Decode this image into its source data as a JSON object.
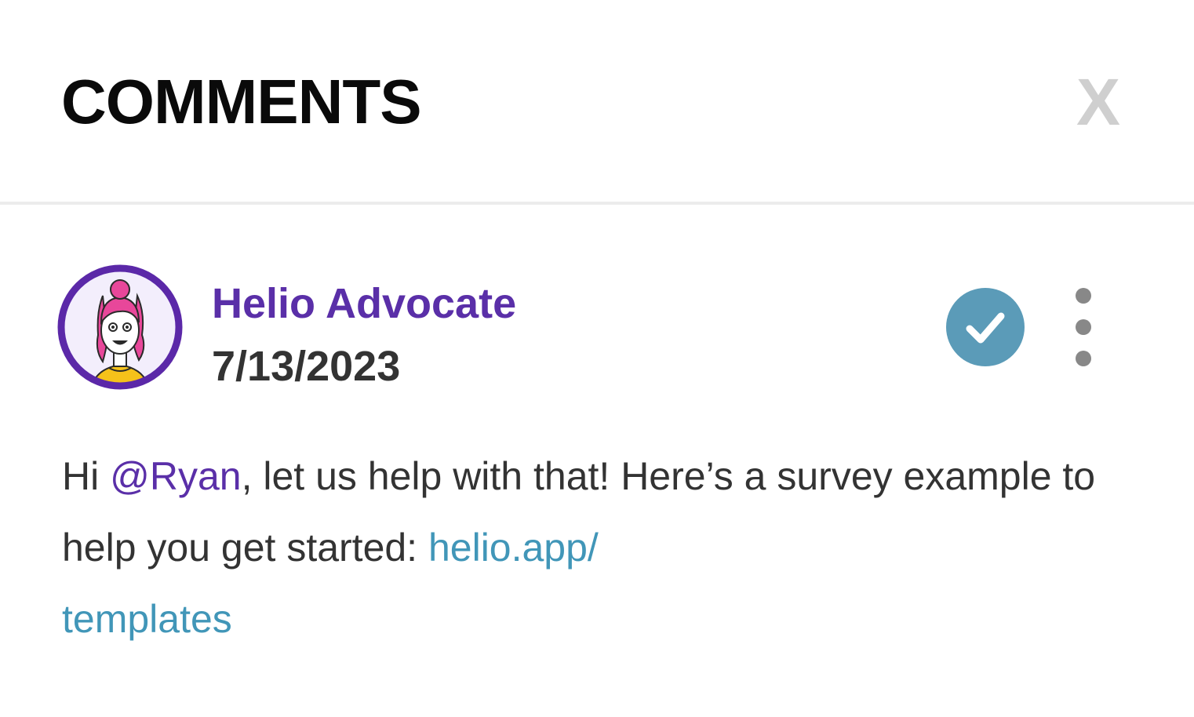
{
  "header": {
    "title": "COMMENTS",
    "close_label": "X"
  },
  "comment": {
    "author": "Helio Advocate",
    "date": "7/13/2023",
    "avatar_icon": "illustrated-woman-avatar",
    "resolve_icon": "check-circle-icon",
    "more_icon": "kebab-menu-icon",
    "body": {
      "text_before_mention": "Hi ",
      "mention": "@Ryan",
      "text_after_mention": ", let us help with that! Here’s a survey example to help you get started: ",
      "link_line1": "helio.app/",
      "link_line2": "templates"
    }
  },
  "colors": {
    "author": "#5a2fa8",
    "mention": "#5a2fa8",
    "link": "#4196b8",
    "resolve_button": "#5b9bb8",
    "close": "#cfcfcf"
  }
}
